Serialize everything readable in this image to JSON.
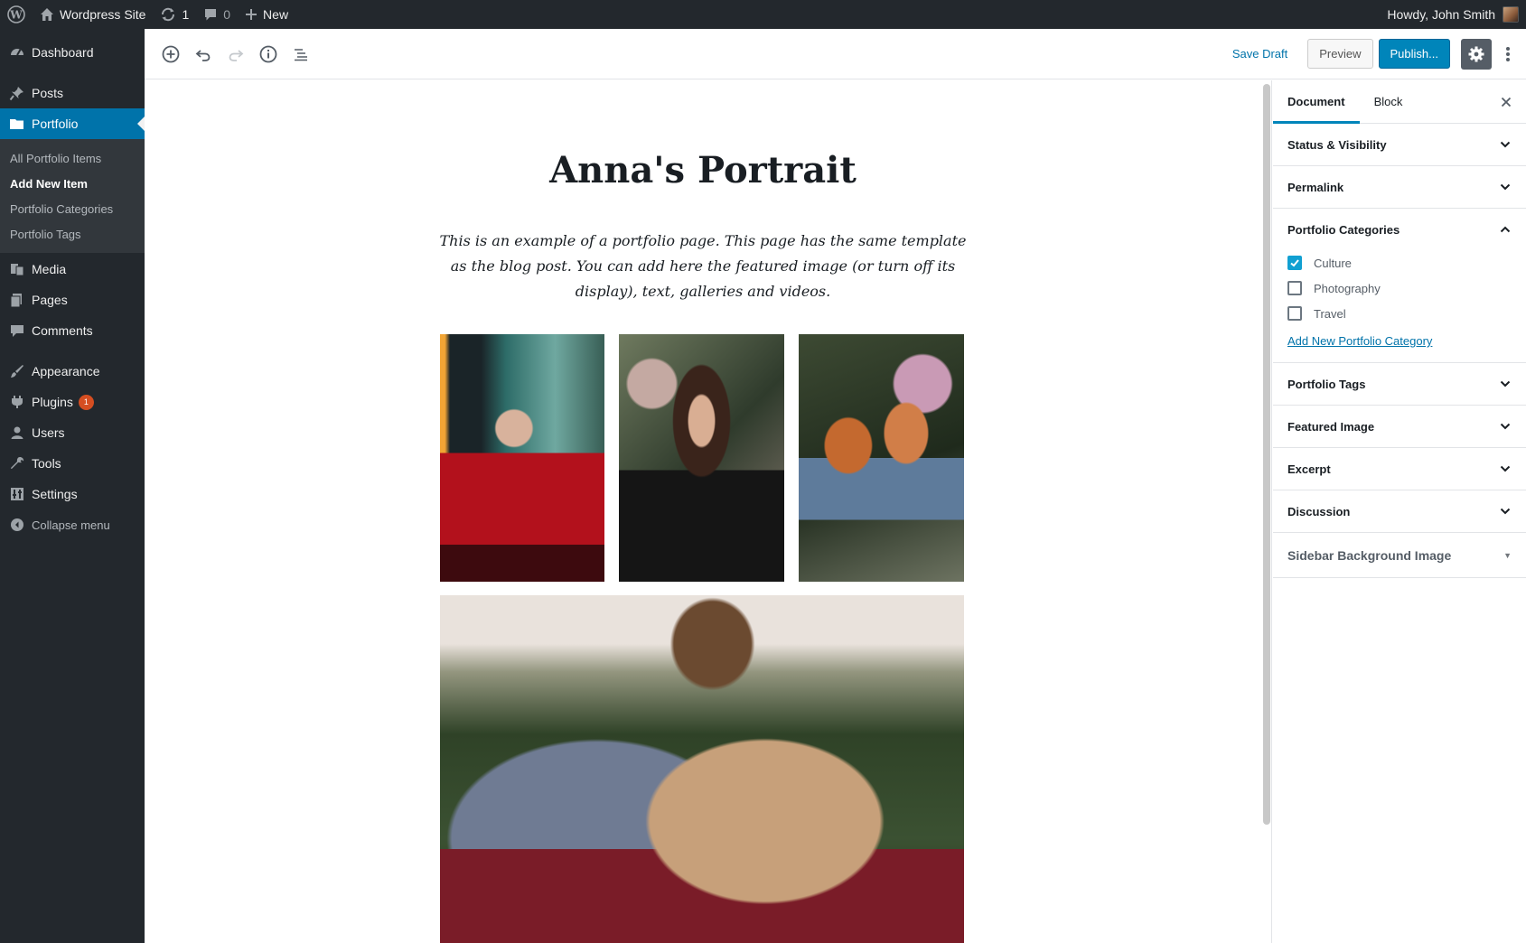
{
  "admin_bar": {
    "site_name": "Wordpress Site",
    "updates_count": "1",
    "comments_count": "0",
    "new_label": "New",
    "greeting": "Howdy, John Smith"
  },
  "admin_menu": {
    "dashboard": "Dashboard",
    "posts": "Posts",
    "portfolio": "Portfolio",
    "portfolio_sub": [
      "All Portfolio Items",
      "Add New Item",
      "Portfolio Categories",
      "Portfolio Tags"
    ],
    "media": "Media",
    "pages": "Pages",
    "comments": "Comments",
    "appearance": "Appearance",
    "plugins": "Plugins",
    "plugins_badge": "1",
    "users": "Users",
    "tools": "Tools",
    "settings": "Settings",
    "collapse": "Collapse menu"
  },
  "editor_header": {
    "save_draft": "Save Draft",
    "preview": "Preview",
    "publish": "Publish..."
  },
  "post": {
    "title": "Anna's Portrait",
    "intro": "This is an example of a portfolio page. This page has the same template as the blog post. You can add here the featured image (or turn off its display), text, galleries and videos."
  },
  "sidebar": {
    "tabs": [
      "Document",
      "Block"
    ],
    "panels": {
      "status": "Status & Visibility",
      "permalink": "Permalink",
      "categories": "Portfolio Categories",
      "tags": "Portfolio Tags",
      "featured": "Featured Image",
      "excerpt": "Excerpt",
      "discussion": "Discussion"
    },
    "categories": [
      {
        "label": "Culture",
        "checked": true
      },
      {
        "label": "Photography",
        "checked": false
      },
      {
        "label": "Travel",
        "checked": false
      }
    ],
    "add_category": "Add New Portfolio Category",
    "meta_box": "Sidebar Background Image"
  },
  "colors": {
    "admin_bg": "#23282d",
    "accent": "#0073aa",
    "publish": "#0085ba",
    "checkbox": "#11a0d2"
  }
}
